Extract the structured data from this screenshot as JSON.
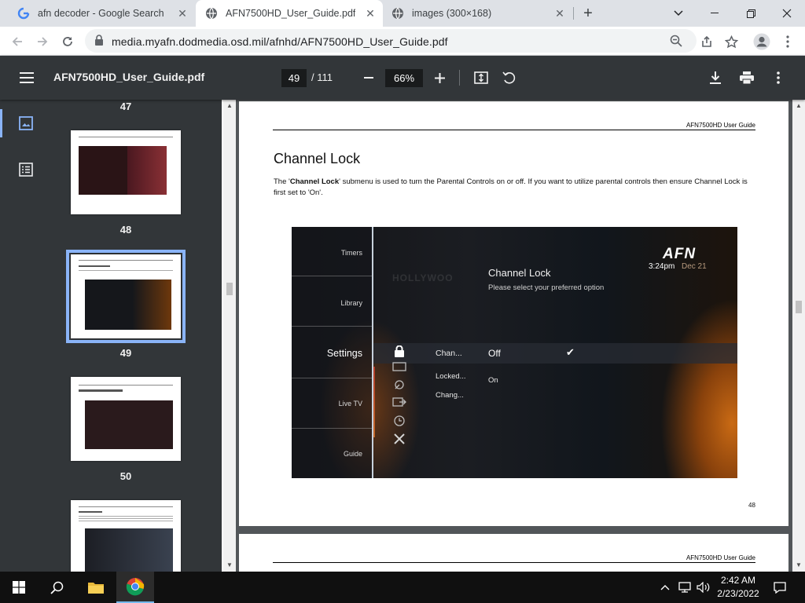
{
  "tabs": [
    {
      "title": "afn decoder - Google Search",
      "icon": "google-icon",
      "active": false
    },
    {
      "title": "AFN7500HD_User_Guide.pdf",
      "icon": "globe-icon",
      "active": true
    },
    {
      "title": "images (300×168)",
      "icon": "globe-icon",
      "active": false
    }
  ],
  "address_bar": {
    "url": "media.myafn.dodmedia.osd.mil/afnhd/AFN7500HD_User_Guide.pdf"
  },
  "pdf_toolbar": {
    "title": "AFN7500HD_User_Guide.pdf",
    "current_page": "49",
    "total_pages": "/ 111",
    "zoom": "66%"
  },
  "thumbnails": {
    "labels": [
      "47",
      "48",
      "49",
      "50"
    ],
    "selected": "49"
  },
  "document_page": {
    "header": "AFN7500HD User Guide",
    "heading": "Channel Lock",
    "body_prefix": "The '",
    "body_bold": "Channel Lock",
    "body_suffix": "' submenu is used to turn the Parental Controls on or off. If you want to utilize parental controls then ensure Channel Lock is first set to 'On'.",
    "page_number": "48",
    "next_page_header": "AFN7500HD User Guide"
  },
  "tv_screen": {
    "logo": "AFN",
    "time": "3:24pm",
    "date": "Dec 21",
    "title": "Channel Lock",
    "subtitle": "Please select your preferred option",
    "menu": [
      "Timers",
      "Library",
      "Settings",
      "Live TV",
      "Guide"
    ],
    "submenu": [
      "Chan...",
      "Locked...",
      "Chang..."
    ],
    "options": [
      "Off",
      "On"
    ],
    "background_word": "HOLLYWOO"
  },
  "taskbar": {
    "time": "2:42 AM",
    "date": "2/23/2022"
  },
  "colors": {
    "pdf_toolbar": "#323639",
    "accent": "#8ab4f8",
    "viewer_bg": "#525659"
  }
}
